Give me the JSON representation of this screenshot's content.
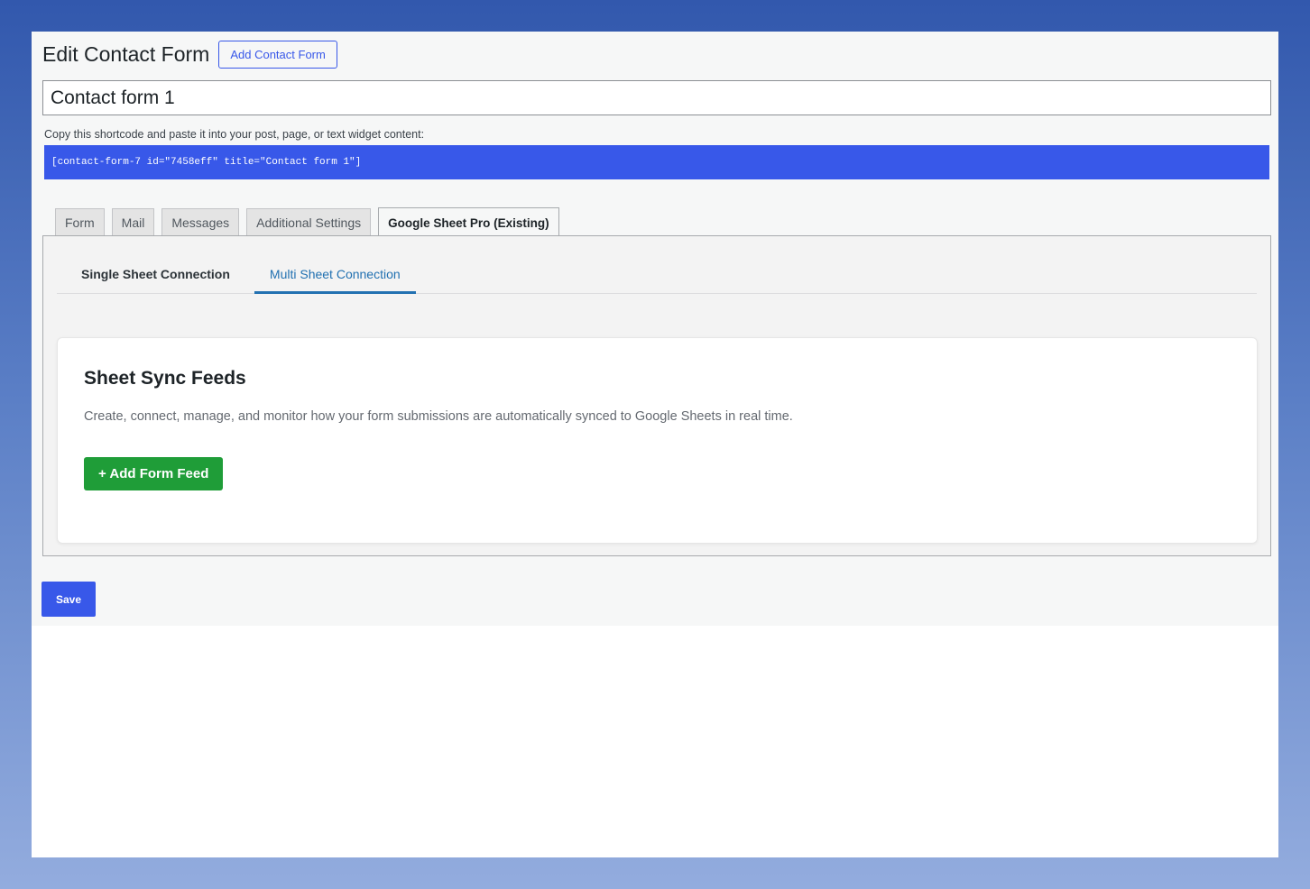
{
  "header": {
    "title": "Edit Contact Form",
    "add_button": "Add Contact Form"
  },
  "form_title_value": "Contact form 1",
  "shortcode": {
    "hint": "Copy this shortcode and paste it into your post, page, or text widget content:",
    "code": "[contact-form-7 id=\"7458eff\" title=\"Contact form 1\"]"
  },
  "tabs": [
    {
      "label": "Form",
      "active": false
    },
    {
      "label": "Mail",
      "active": false
    },
    {
      "label": "Messages",
      "active": false
    },
    {
      "label": "Additional Settings",
      "active": false
    },
    {
      "label": "Google Sheet Pro (Existing)",
      "active": true
    }
  ],
  "subtabs": [
    {
      "label": "Single Sheet Connection",
      "active": false
    },
    {
      "label": "Multi Sheet Connection",
      "active": true
    }
  ],
  "card": {
    "title": "Sheet Sync Feeds",
    "description": "Create, connect, manage, and monitor how your form submissions are automatically synced to Google Sheets in real time.",
    "add_button": "+ Add Form Feed"
  },
  "save_label": "Save",
  "colors": {
    "accent": "#3858e9",
    "success": "#1f9d38",
    "link": "#2271b1"
  }
}
